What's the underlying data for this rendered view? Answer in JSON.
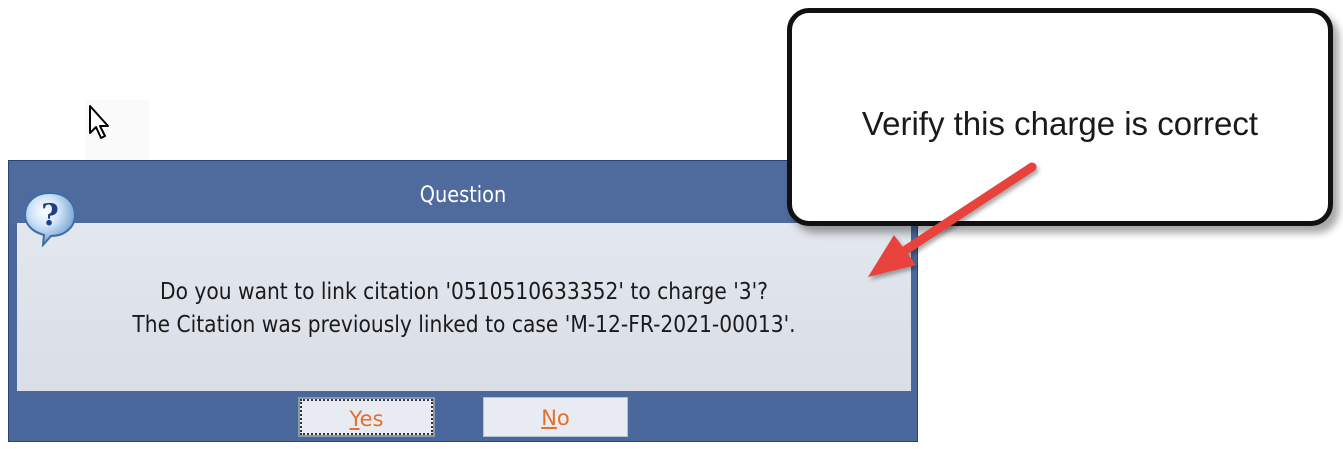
{
  "dialog": {
    "title": "Question",
    "message_line1": "Do you want to link citation '0510510633352' to charge '3'?",
    "message_line2": "The Citation was previously linked to case 'M-12-FR-2021-00013'.",
    "yes_mnemonic": "Y",
    "yes_rest": "es",
    "no_mnemonic": "N",
    "no_rest": "o",
    "icon": "help-question-icon"
  },
  "callout": {
    "text": "Verify this charge is correct",
    "arrow_color": "#e8433d"
  },
  "colors": {
    "dialog_frame": "#4a689b",
    "dialog_body": "#dfe3eb",
    "button_text": "#e2702e"
  }
}
